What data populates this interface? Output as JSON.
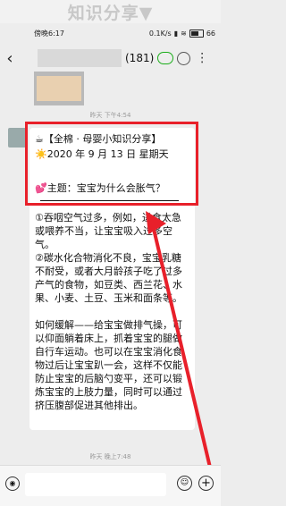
{
  "overlay_title": "知识分享▼",
  "status": {
    "time": "傍晚6:17",
    "net_speed": "0.1K/s",
    "battery": "66"
  },
  "header": {
    "back_icon": "‹",
    "member_count": "(181)",
    "more_icon": "⋮"
  },
  "timestamps": {
    "first": "昨天 下午4:54",
    "second": "昨天 晚上7:48"
  },
  "message": {
    "title": "☕【全棉 · 母婴小知识分享】",
    "date": "☀️2020 年 9 月 13 日 星期天",
    "topic": "💕主题：宝宝为什么会胀气？",
    "body_lines": [
      "①吞咽空气过多，例如，进食太急",
      "或喂养不当，让宝宝吸入过多空",
      "气。",
      "②碳水化合物消化不良，宝宝乳糖",
      "不耐受，或者大月龄孩子吃了过多",
      "产气的食物，如豆类、西兰花、水",
      "果、小麦、土豆、玉米和面条等。",
      "",
      "如何缓解——给宝宝做排气操，可",
      "以仰面躺着床上，抓着宝宝的腿做",
      "自行车运动。也可以在宝宝消化食",
      "物过后让宝宝趴一会，这样不仅能",
      "防止宝宝的后脑勺变平，还可以锻",
      "炼宝宝的上肢力量，同时可以通过",
      "挤压腹部促进其他排出。"
    ]
  },
  "input_bar": {
    "voice_icon": "◉",
    "emoji_icon": "☺",
    "plus_icon": "+"
  },
  "colors": {
    "highlight": "#e8202a",
    "background": "#ededed",
    "bubble": "#ffffff"
  }
}
